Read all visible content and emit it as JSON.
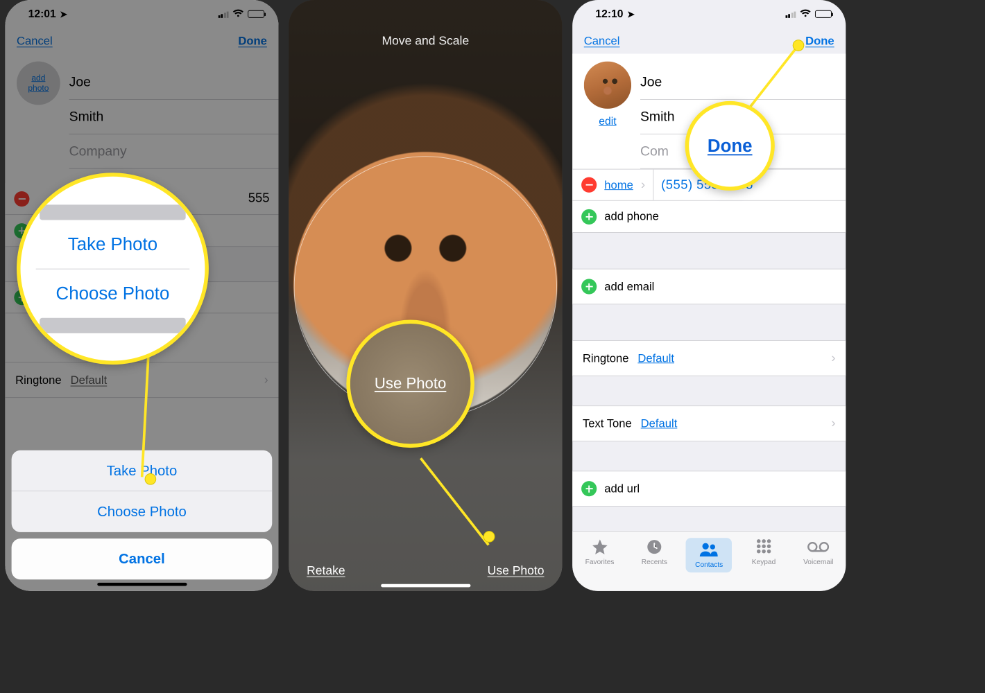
{
  "screen1": {
    "status": {
      "time": "12:01"
    },
    "nav": {
      "cancel": "Cancel",
      "done": "Done"
    },
    "avatar_label_line1": "add",
    "avatar_label_line2": "photo",
    "fields": {
      "first": "Joe",
      "last": "Smith",
      "company": "Company"
    },
    "phone_suffix": "555",
    "ringtone_label": "Ringtone",
    "ringtone_value": "Default",
    "sheet": {
      "take": "Take Photo",
      "choose": "Choose Photo",
      "cancel": "Cancel"
    }
  },
  "screen2": {
    "title": "Move and Scale",
    "retake": "Retake",
    "use": "Use Photo",
    "magnifier_use": "Use Photo"
  },
  "screen3": {
    "status": {
      "time": "12:10"
    },
    "nav": {
      "cancel": "Cancel",
      "done": "Done"
    },
    "edit": "edit",
    "fields": {
      "first": "Joe",
      "last": "Smith",
      "company": "Com"
    },
    "phone": {
      "label": "home",
      "value": "(555) 555-5555"
    },
    "add_phone": "add phone",
    "add_email": "add email",
    "ringtone_label": "Ringtone",
    "ringtone_value": "Default",
    "texttone_label": "Text Tone",
    "texttone_value": "Default",
    "add_url": "add url",
    "magnifier_done": "Done",
    "tabs": {
      "favorites": "Favorites",
      "recents": "Recents",
      "contacts": "Contacts",
      "keypad": "Keypad",
      "voicemail": "Voicemail"
    }
  }
}
